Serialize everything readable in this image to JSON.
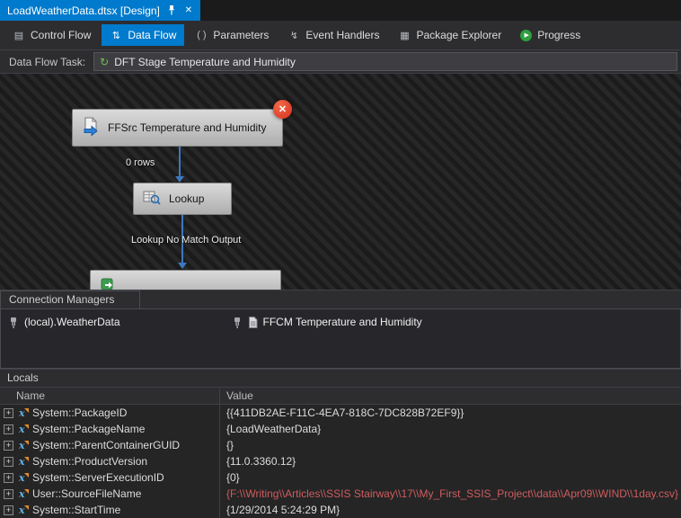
{
  "window": {
    "tab_title": "LoadWeatherData.dtsx [Design]"
  },
  "colors": {
    "accent": "#007acc",
    "error_badge": "#d92f1c",
    "changed_value": "#d05c5c"
  },
  "toolbar": {
    "tabs": [
      {
        "label": "Control Flow",
        "active": false
      },
      {
        "label": "Data Flow",
        "active": true
      },
      {
        "label": "Parameters",
        "active": false
      },
      {
        "label": "Event Handlers",
        "active": false
      },
      {
        "label": "Package Explorer",
        "active": false
      },
      {
        "label": "Progress",
        "active": false
      }
    ]
  },
  "task_selector": {
    "label": "Data Flow Task:",
    "value": "DFT Stage Temperature and Humidity"
  },
  "design_surface": {
    "nodes": [
      {
        "label": "FFSrc Temperature and Humidity",
        "icon": "flat-file-source-icon",
        "error": true
      },
      {
        "label": "Lookup",
        "icon": "lookup-icon",
        "error": false
      }
    ],
    "connectors": [
      {
        "label": "0 rows"
      },
      {
        "label": "Lookup No Match Output"
      }
    ]
  },
  "connection_managers": {
    "title": "Connection Managers",
    "items": [
      {
        "label": "(local).WeatherData",
        "icon": "connection-icon"
      },
      {
        "label": "FFCM Temperature and Humidity",
        "icon": "flat-file-connection-icon"
      }
    ]
  },
  "locals": {
    "title": "Locals",
    "columns": [
      "Name",
      "Value"
    ],
    "rows": [
      {
        "name": "System::PackageID",
        "value": "{{411DB2AE-F11C-4EA7-818C-7DC828B72EF9}}",
        "changed": false
      },
      {
        "name": "System::PackageName",
        "value": "{LoadWeatherData}",
        "changed": false
      },
      {
        "name": "System::ParentContainerGUID",
        "value": "{}",
        "changed": false
      },
      {
        "name": "System::ProductVersion",
        "value": "{11.0.3360.12}",
        "changed": false
      },
      {
        "name": "System::ServerExecutionID",
        "value": "{0}",
        "changed": false
      },
      {
        "name": "User::SourceFileName",
        "value": "{F:\\\\Writing\\\\Articles\\\\SSIS Stairway\\\\17\\\\My_First_SSIS_Project\\\\data\\\\Apr09\\\\WIND\\\\1day.csv}",
        "changed": true
      },
      {
        "name": "System::StartTime",
        "value": "{1/29/2014 5:24:29 PM}",
        "changed": false
      }
    ]
  }
}
